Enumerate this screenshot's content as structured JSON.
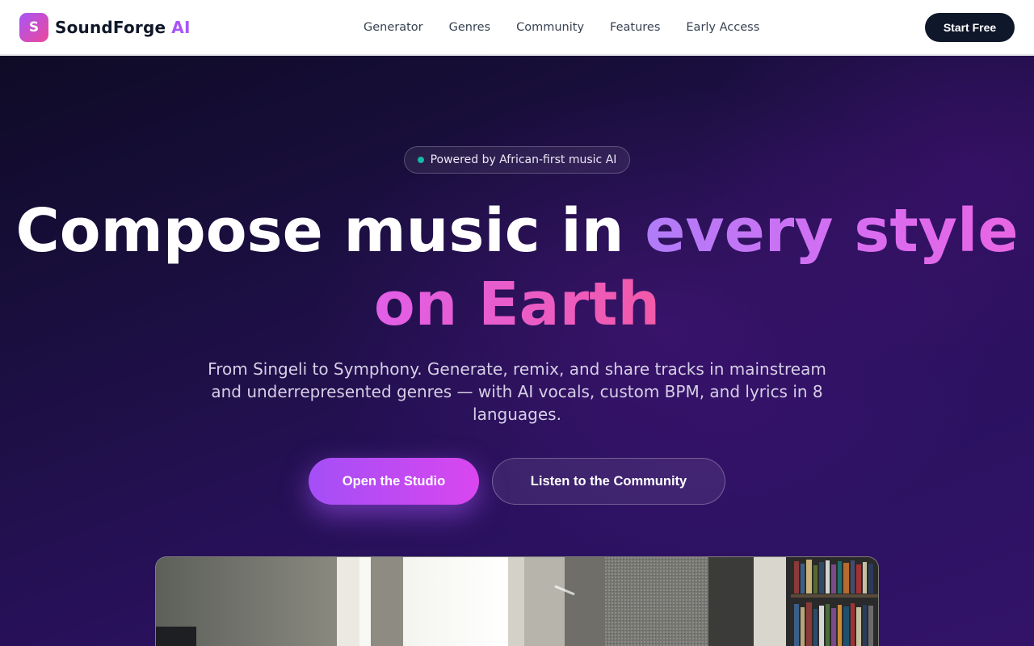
{
  "nav": {
    "brand_initial": "S",
    "brand_name": "SoundForge",
    "brand_suffix": "AI",
    "links": [
      "Generator",
      "Genres",
      "Community",
      "Features",
      "Early Access"
    ],
    "cta_label": "Start Free"
  },
  "hero": {
    "badge_text": "Powered by African-first music AI",
    "headline_part1": "Compose music in ",
    "headline_highlight1": "every style",
    "headline_highlight2": "on Earth",
    "subtitle": "From Singeli to Symphony. Generate, remix, and share tracks in mainstream and underrepresented genres — with AI vocals, custom BPM, and lyrics in 8 languages.",
    "primary_button": "Open the Studio",
    "secondary_button": "Listen to the Community"
  },
  "colors": {
    "brand_accent": "#a855f7",
    "brand_gradient_end": "#ec4899",
    "nav_cta_bg": "#0f172a",
    "hero_bg_start": "#0f0b26",
    "hero_bg_end": "#321368",
    "badge_dot": "#14b8a6"
  }
}
